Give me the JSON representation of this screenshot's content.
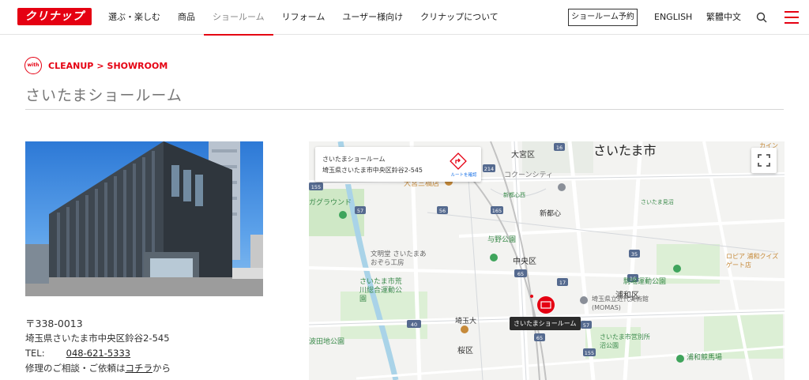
{
  "header": {
    "logo_text": "クリナップ",
    "nav": [
      "選ぶ・楽しむ",
      "商品",
      "ショールーム",
      "リフォーム",
      "ユーザー様向け",
      "クリナップについて"
    ],
    "reserve_label": "ショールーム予約",
    "lang_en": "ENGLISH",
    "lang_zh": "繁體中文"
  },
  "breadcrumb": {
    "badge": "with",
    "brand": "CLEANUP",
    "separator": ">",
    "section": "SHOWROOM"
  },
  "page_title": "さいたまショールーム",
  "info": {
    "postal": "〒338-0013",
    "address": "埼玉県さいたま市中央区鈴谷2-545",
    "tel_label": "TEL:",
    "tel": "048-621-5333",
    "repair_prefix": "修理のご相談・ご依頼は",
    "repair_link": "コチラ",
    "repair_suffix": "から"
  },
  "map": {
    "card_name": "さいたまショールーム",
    "card_address": "埼玉県さいたま市中央区鈴谷2-545",
    "route_label": "ルートを確認",
    "pin_label": "さいたまショールーム",
    "labels": {
      "city": "さいたま市",
      "omiya": "大宮区",
      "cocoon": "コクーンシティ",
      "omiya_store": "大宮三橋店",
      "shintoshin_st": "新都心西",
      "shintoshin": "新都心",
      "yono_park": "与野公園",
      "chuo": "中央区",
      "urawa": "浦和区",
      "komaba": "駒場運動公園",
      "urawa_race": "浦和競馬場",
      "museum": "埼玉県立近代美術館(MOMAS)",
      "bessho": "さいたま市営別所沼公園",
      "arakawa": "さいたま市荒川総合運動公園",
      "bunmei": "文明堂 さいたまあおぞら工房",
      "saitama_u": "埼玉大",
      "sakura": "桜区",
      "ground": "ガグラウンド",
      "tajima": "波田地公園",
      "omiya_station": "さいたま見沼",
      "rohpia": "ロピア 浦和クイズゲート店",
      "kain": "カイン"
    },
    "route_numbers": [
      "214",
      "16",
      "155",
      "56",
      "57",
      "165",
      "65",
      "17",
      "40",
      "155",
      "65",
      "35",
      "16",
      "57",
      "65"
    ]
  },
  "colors": {
    "brand": "#e50012",
    "nav_active": "#888888",
    "title": "#777777",
    "map_bg": "#f3f3f1",
    "park": "#cfe8c6",
    "water": "#a9d3e8"
  }
}
